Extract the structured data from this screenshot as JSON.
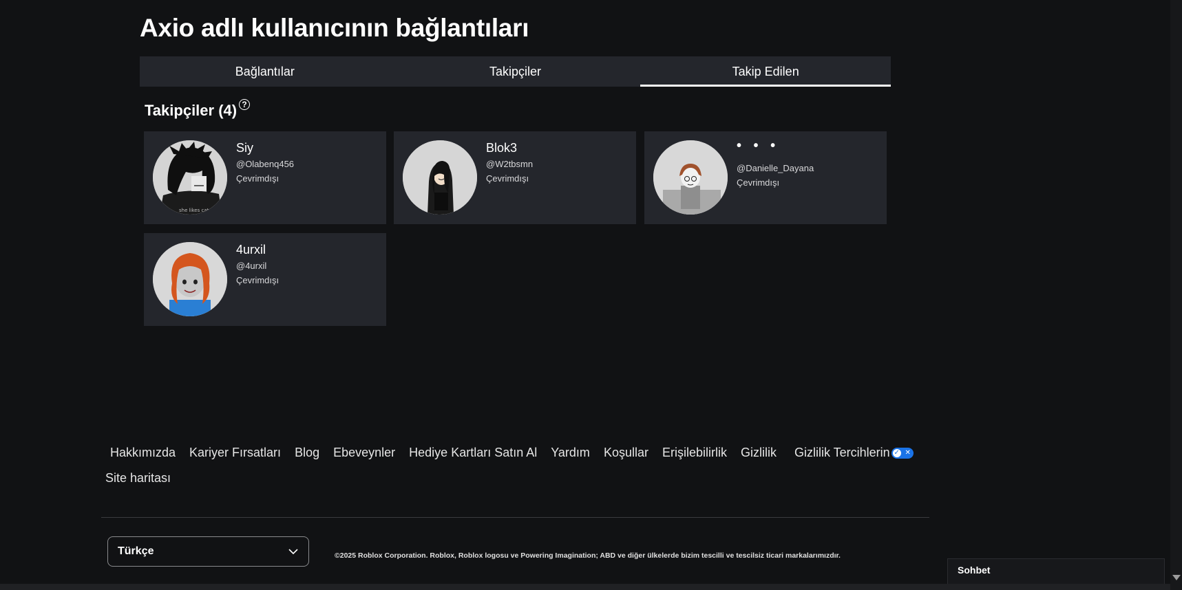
{
  "page": {
    "title": "Axio adlı kullanıcının bağlantıları"
  },
  "tabs": [
    {
      "label": "Bağlantılar"
    },
    {
      "label": "Takipçiler"
    },
    {
      "label": "Takip Edilen"
    }
  ],
  "section": {
    "title": "Takipçiler (4)",
    "help_icon": "?"
  },
  "cards": [
    {
      "name": "Siy",
      "username": "@Olabenq456",
      "status": "Çevrimdışı"
    },
    {
      "name": "Blok3",
      "username": "@W2tbsmn",
      "status": "Çevrimdışı"
    },
    {
      "name": "• • •",
      "username": "@Danielle_Dayana",
      "status": "Çevrimdışı"
    },
    {
      "name": "4urxil",
      "username": "@4urxil",
      "status": "Çevrimdışı"
    }
  ],
  "footer": {
    "links": [
      "Hakkımızda",
      "Kariyer Fırsatları",
      "Blog",
      "Ebeveynler",
      "Hediye Kartları Satın Al",
      "Yardım",
      "Koşullar",
      "Erişilebilirlik",
      "Gizlilik"
    ],
    "privacy_preferences": "Gizlilik Tercihlerin",
    "sitemap": "Site haritası",
    "language": "Türkçe",
    "copyright": "©2025 Roblox Corporation. Roblox, Roblox logosu ve Powering Imagination; ABD ve diğer ülkelerde bizim tescilli ve tescilsiz ticari markalarımızdır."
  },
  "chat": {
    "label": "Sohbet"
  },
  "colors": {
    "background": "#111214",
    "card": "#24262c",
    "toggle_accent": "#1a73e8"
  }
}
